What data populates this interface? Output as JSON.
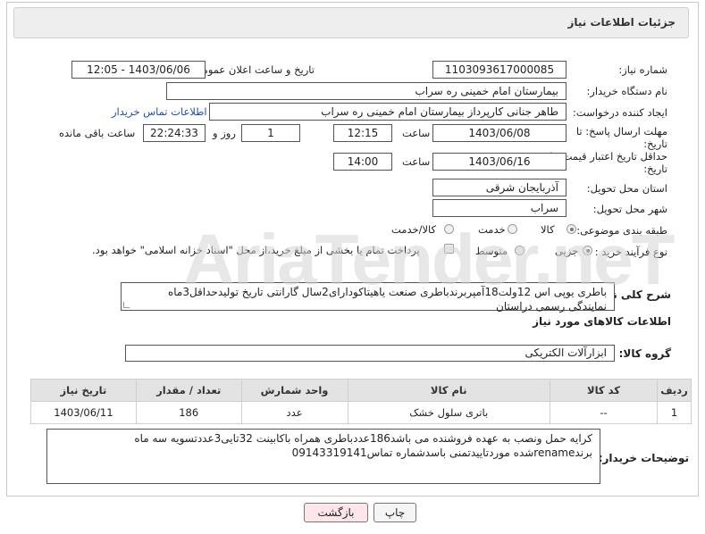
{
  "header": {
    "title": "جزئیات اطلاعات نیاز"
  },
  "fields": {
    "need_number_label": "شماره نیاز:",
    "need_number": "1103093617000085",
    "announce_label": "تاریخ و ساعت اعلان عمومی:",
    "announce_value": "1403/06/06 - 12:05",
    "buyer_label": "نام دستگاه خریدار:",
    "buyer_value": "بیمارستان امام خمینی ره  سراب",
    "creator_label": "ایجاد کننده درخواست:",
    "creator_value": "طاهر جنانی کارپرداز بیمارستان امام خمینی ره  سراب",
    "contact_link": "اطلاعات تماس خریدار",
    "deadline_label": "مهلت ارسال پاسخ: تا تاریخ:",
    "deadline_date": "1403/06/08",
    "time_label": "ساعت",
    "deadline_time": "12:15",
    "days_value": "1",
    "days_label": "روز و",
    "remaining_time": "22:24:33",
    "remaining_label": "ساعت باقی مانده",
    "validity_label": "حداقل تاریخ اعتبار قیمت: تا تاریخ:",
    "validity_date": "1403/06/16",
    "validity_time": "14:00",
    "province_label": "استان محل تحویل:",
    "province_value": "آذربایجان شرقی",
    "city_label": "شهر محل تحویل:",
    "city_value": "سراب",
    "category_label": "طبقه بندی موضوعی:",
    "category_options": [
      "کالا",
      "خدمت",
      "کالا/خدمت"
    ],
    "category_selected": "کالا",
    "process_label": "نوع فرآیند خرید :",
    "process_options": [
      "جزیی",
      "متوسط"
    ],
    "process_selected": "جزیی",
    "payment_note": "پرداخت تمام یا بخشی از مبلغ خرید،از محل \"اسناد خزانه اسلامی\" خواهد بود."
  },
  "description": {
    "label": "شرح کلی نیاز:",
    "text": "باطری یوپی اس 12ولت18آمپربرندباطری صنعت یاهیتاکودارای2سال گارانتی تاریخ تولیدحداقل3ماه نمایندگی رسمی دراستان"
  },
  "goods": {
    "section_title": "اطلاعات کالاهای مورد نیاز",
    "group_label": "گروه کالا:",
    "group_value": "ابزارآلات الکتریکی",
    "columns": [
      "ردیف",
      "کد کالا",
      "نام کالا",
      "واحد شمارش",
      "تعداد / مقدار",
      "تاریخ نیاز"
    ],
    "rows": [
      [
        "1",
        "--",
        "باتری سلول خشک",
        "عدد",
        "186",
        "1403/06/11"
      ]
    ]
  },
  "buyer_notes": {
    "label": "توضیحات خریدار:",
    "text": "کرایه حمل ونصب به عهده فروشنده می باشد186عددباطری همراه باکابینت 32تایی3عددتسویه سه ماه برندrenameشده موردتاییدتمنی باسدشماره تماس09143319141"
  },
  "buttons": {
    "print": "چاپ",
    "back": "بازگشت"
  },
  "watermark": "AriaTender.neT"
}
